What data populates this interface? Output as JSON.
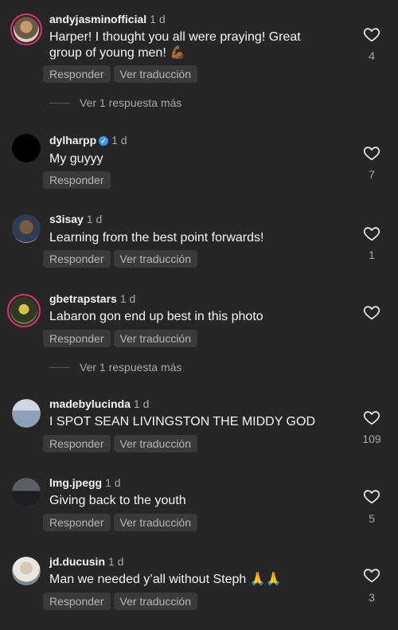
{
  "comments": [
    {
      "username": "andyjasminofficial",
      "time": "1 d",
      "text": "Harper! I thought you all were praying! Great group of young men! 💪🏾",
      "reply_label": "Responder",
      "translate_label": "Ver traducción",
      "likes": "4",
      "more_replies": "Ver 1 respuesta más"
    },
    {
      "username": "dylharpp",
      "time": "1 d",
      "text": "My guyyy",
      "reply_label": "Responder",
      "likes": "7"
    },
    {
      "username": "s3isay",
      "time": "1 d",
      "text": "Learning from the best point forwards!",
      "reply_label": "Responder",
      "translate_label": "Ver traducción",
      "likes": "1"
    },
    {
      "username": "gbetrapstars",
      "time": "1 d",
      "text": "Labaron gon end up best in this photo",
      "reply_label": "Responder",
      "translate_label": "Ver traducción",
      "more_replies": "Ver 1 respuesta más"
    },
    {
      "username": "madebylucinda",
      "time": "1 d",
      "text": "I SPOT SEAN LIVINGSTON THE MIDDY GOD",
      "reply_label": "Responder",
      "translate_label": "Ver traducción",
      "likes": "109"
    },
    {
      "username": "lmg.jpegg",
      "time": "1 d",
      "text": "Giving back to the youth",
      "reply_label": "Responder",
      "translate_label": "Ver traducción",
      "likes": "5"
    },
    {
      "username": "jd.ducusin",
      "time": "1 d",
      "text": "Man we needed y’all without Steph 🙏🙏",
      "reply_label": "Responder",
      "translate_label": "Ver traducción",
      "likes": "3"
    }
  ],
  "icons": {
    "like": "heart-outline-icon",
    "verified": "verified-badge-icon"
  },
  "colors": {
    "background": "#262626",
    "verified": "#3897f0",
    "story_ring": "#e1306c"
  }
}
